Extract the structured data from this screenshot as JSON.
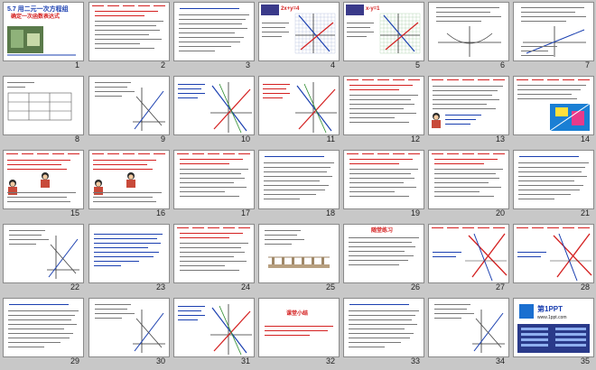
{
  "slides": [
    {
      "n": "1",
      "kind": "title",
      "title": "5.7 用二元一次方程组",
      "subtitle": "确定一次函数表达式"
    },
    {
      "n": "2",
      "kind": "text-red"
    },
    {
      "n": "3",
      "kind": "text-dark"
    },
    {
      "n": "4",
      "kind": "graph",
      "eq": "2x+y=4"
    },
    {
      "n": "5",
      "kind": "graph-green",
      "eq": "x-y=1"
    },
    {
      "n": "6",
      "kind": "diagram"
    },
    {
      "n": "7",
      "kind": "diagram2"
    },
    {
      "n": "8",
      "kind": "table"
    },
    {
      "n": "9",
      "kind": "graph-small"
    },
    {
      "n": "10",
      "kind": "lines-blue"
    },
    {
      "n": "11",
      "kind": "lines-red"
    },
    {
      "n": "12",
      "kind": "text-red"
    },
    {
      "n": "13",
      "kind": "text-person"
    },
    {
      "n": "14",
      "kind": "colorful"
    },
    {
      "n": "15",
      "kind": "person"
    },
    {
      "n": "16",
      "kind": "person"
    },
    {
      "n": "17",
      "kind": "text-red"
    },
    {
      "n": "18",
      "kind": "text-dark"
    },
    {
      "n": "19",
      "kind": "text-red"
    },
    {
      "n": "20",
      "kind": "text-red"
    },
    {
      "n": "21",
      "kind": "text-dark"
    },
    {
      "n": "22",
      "kind": "graph-small"
    },
    {
      "n": "23",
      "kind": "text-blue"
    },
    {
      "n": "24",
      "kind": "text-red"
    },
    {
      "n": "25",
      "kind": "bridge"
    },
    {
      "n": "26",
      "kind": "practice",
      "heading": "随堂练习"
    },
    {
      "n": "27",
      "kind": "lines-cross"
    },
    {
      "n": "28",
      "kind": "lines-cross"
    },
    {
      "n": "29",
      "kind": "text-dark"
    },
    {
      "n": "30",
      "kind": "graph-small"
    },
    {
      "n": "31",
      "kind": "lines-blue"
    },
    {
      "n": "32",
      "kind": "summary",
      "heading": "课堂小结"
    },
    {
      "n": "33",
      "kind": "text-dark"
    },
    {
      "n": "34",
      "kind": "graph-small"
    },
    {
      "n": "35",
      "kind": "brand",
      "brand": "第1PPT",
      "url": "www.1ppt.com"
    }
  ]
}
